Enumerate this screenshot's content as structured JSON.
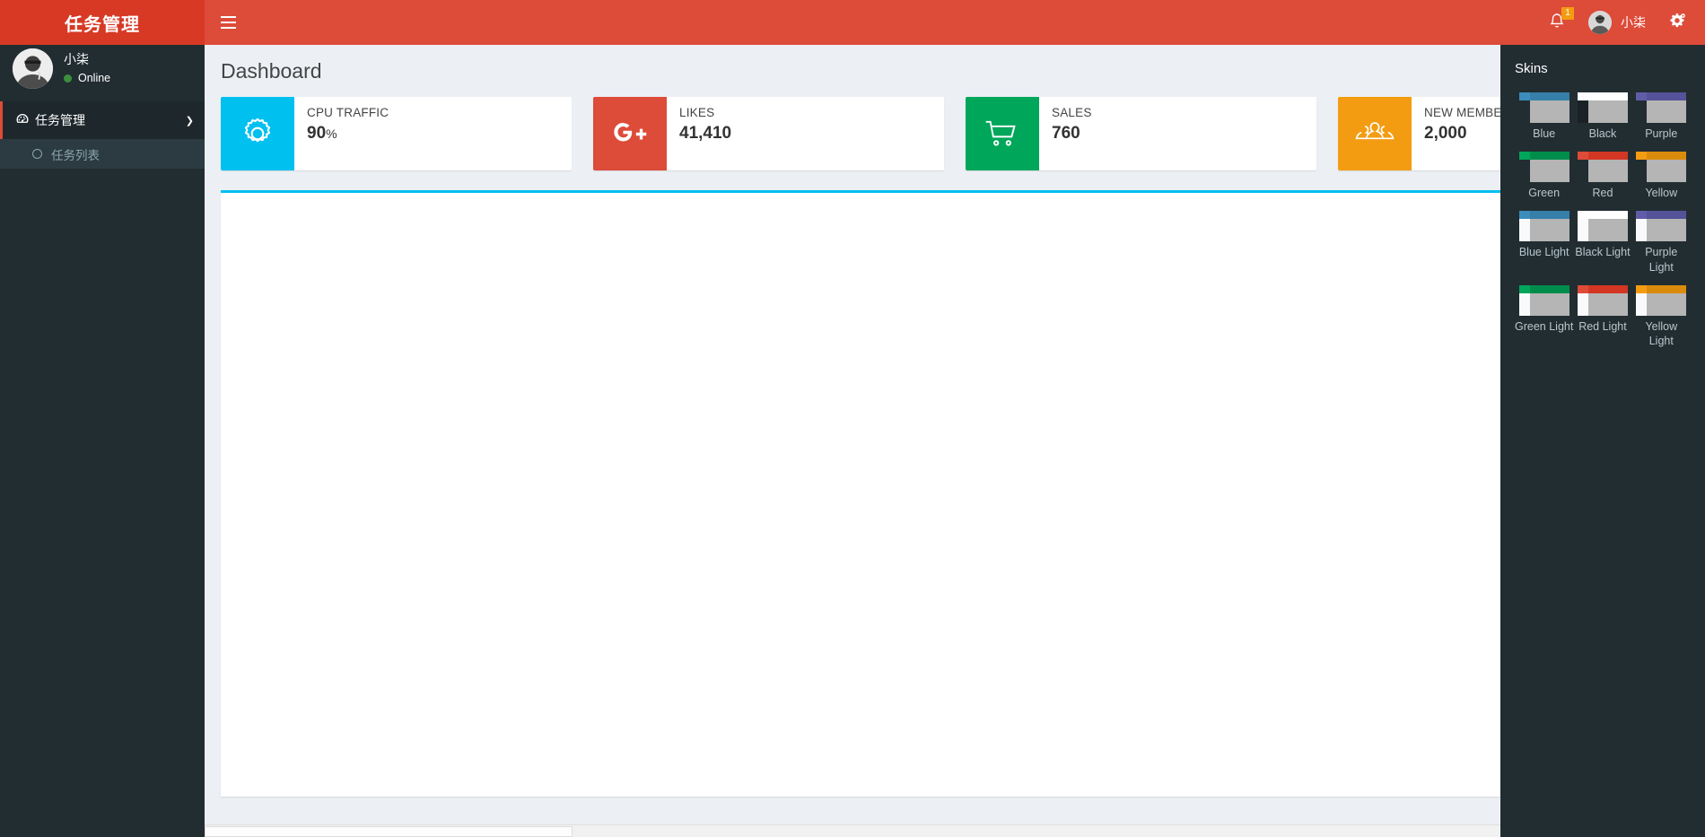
{
  "navbar": {
    "logo_text": "任务管理",
    "toggle_icon": "hamburger-icon",
    "notifications": {
      "icon": "bell-icon",
      "badge": "1"
    },
    "user": {
      "name": "小柒",
      "avatar_icon": "user-avatar"
    },
    "settings": {
      "icon": "gear-cogs-icon"
    },
    "colors": {
      "navbar_bg": "#dd4b39",
      "logo_bg": "#d73925",
      "badge_bg": "#f39c12"
    }
  },
  "sidebar": {
    "user_panel": {
      "name": "小柒",
      "status": "Online",
      "status_color": "#3c8f3c"
    },
    "menu": [
      {
        "label": "任务管理",
        "icon": "dashboard-icon",
        "chevron": "chevron-down-icon",
        "active": true,
        "submenu": [
          {
            "label": "任务列表",
            "icon": "circle-o-icon"
          }
        ]
      }
    ],
    "colors": {
      "bg": "#222d32",
      "active_bg": "#1e282c",
      "submenu_bg": "#2c3b41",
      "accent": "#dd4b39"
    }
  },
  "content": {
    "page_title": "Dashboard",
    "info_boxes": [
      {
        "text": "CPU TRAFFIC",
        "number": "90",
        "unit": "%",
        "icon": "gear-icon",
        "color": "#00c0ef"
      },
      {
        "text": "LIKES",
        "number": "41,410",
        "unit": "",
        "icon": "google-plus-icon",
        "color": "#dd4b39"
      },
      {
        "text": "SALES",
        "number": "760",
        "unit": "",
        "icon": "shopping-cart-icon",
        "color": "#00a65a"
      },
      {
        "text": "NEW MEMBERS",
        "number": "2,000",
        "unit": "",
        "icon": "users-icon",
        "color": "#f39c12"
      }
    ],
    "panel_accent_color": "#00c0ef"
  },
  "control_sidebar": {
    "title": "Skins",
    "skins": [
      {
        "label": "Blue",
        "top": "#367fa9",
        "top_left": "#3c8dbc",
        "body_left": "#222d32"
      },
      {
        "label": "Black",
        "top": "#fefefe",
        "top_left": "#fefefe",
        "body_left": "#1a2226"
      },
      {
        "label": "Purple",
        "top": "#555299",
        "top_left": "#605ca8",
        "body_left": "#222d32"
      },
      {
        "label": "Green",
        "top": "#008d4c",
        "top_left": "#00a65a",
        "body_left": "#222d32"
      },
      {
        "label": "Red",
        "top": "#d33724",
        "top_left": "#dd4b39",
        "body_left": "#222d32"
      },
      {
        "label": "Yellow",
        "top": "#db8b0b",
        "top_left": "#f39c12",
        "body_left": "#222d32"
      },
      {
        "label": "Blue Light",
        "top": "#367fa9",
        "top_left": "#3c8dbc",
        "body_left": "#f9fafc"
      },
      {
        "label": "Black Light",
        "top": "#fefefe",
        "top_left": "#fefefe",
        "body_left": "#f9fafc"
      },
      {
        "label": "Purple Light",
        "top": "#555299",
        "top_left": "#605ca8",
        "body_left": "#f9fafc"
      },
      {
        "label": "Green Light",
        "top": "#008d4c",
        "top_left": "#00a65a",
        "body_left": "#f9fafc"
      },
      {
        "label": "Red Light",
        "top": "#d33724",
        "top_left": "#dd4b39",
        "body_left": "#f9fafc"
      },
      {
        "label": "Yellow Light",
        "top": "#db8b0b",
        "top_left": "#f39c12",
        "body_left": "#f9fafc"
      }
    ]
  }
}
